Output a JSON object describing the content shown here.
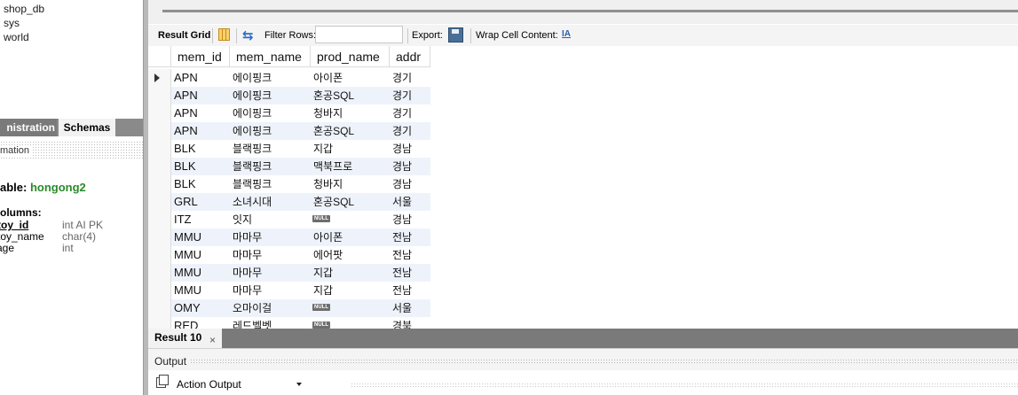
{
  "navigator": {
    "schemas": [
      "shop_db",
      "sys",
      "world"
    ],
    "tabs": {
      "administration": "nistration",
      "schemas": "Schemas"
    },
    "information_label": "mation",
    "table_label": "able:",
    "table_name": "hongong2",
    "columns_label": "olumns:",
    "columns": [
      {
        "name": "toy_id",
        "type": "int AI PK"
      },
      {
        "name": "toy_name",
        "type": "char(4)"
      },
      {
        "name": "age",
        "type": "int"
      }
    ]
  },
  "toolbar": {
    "result_grid": "Result Grid",
    "filter_rows": "Filter Rows:",
    "filter_value": "",
    "export": "Export:",
    "wrap_cell": "Wrap Cell Content:",
    "wrap_icon": "IA"
  },
  "grid": {
    "columns": [
      "mem_id",
      "mem_name",
      "prod_name",
      "addr"
    ],
    "rows": [
      [
        "APN",
        "에이핑크",
        "아이폰",
        "경기"
      ],
      [
        "APN",
        "에이핑크",
        "혼공SQL",
        "경기"
      ],
      [
        "APN",
        "에이핑크",
        "청바지",
        "경기"
      ],
      [
        "APN",
        "에이핑크",
        "혼공SQL",
        "경기"
      ],
      [
        "BLK",
        "블랙핑크",
        "지갑",
        "경남"
      ],
      [
        "BLK",
        "블랙핑크",
        "맥북프로",
        "경남"
      ],
      [
        "BLK",
        "블랙핑크",
        "청바지",
        "경남"
      ],
      [
        "GRL",
        "소녀시대",
        "혼공SQL",
        "서울"
      ],
      [
        "ITZ",
        "잇지",
        "NULL",
        "경남"
      ],
      [
        "MMU",
        "마마무",
        "아이폰",
        "전남"
      ],
      [
        "MMU",
        "마마무",
        "에어팟",
        "전남"
      ],
      [
        "MMU",
        "마마무",
        "지갑",
        "전남"
      ],
      [
        "MMU",
        "마마무",
        "지갑",
        "전남"
      ],
      [
        "OMY",
        "오마이걸",
        "NULL",
        "서울"
      ],
      [
        "RED",
        "레드벨벳",
        "NULL",
        "경북"
      ]
    ]
  },
  "result_tab": {
    "label": "Result 10",
    "close": "×"
  },
  "output": {
    "title": "Output",
    "selector": "Action Output"
  }
}
